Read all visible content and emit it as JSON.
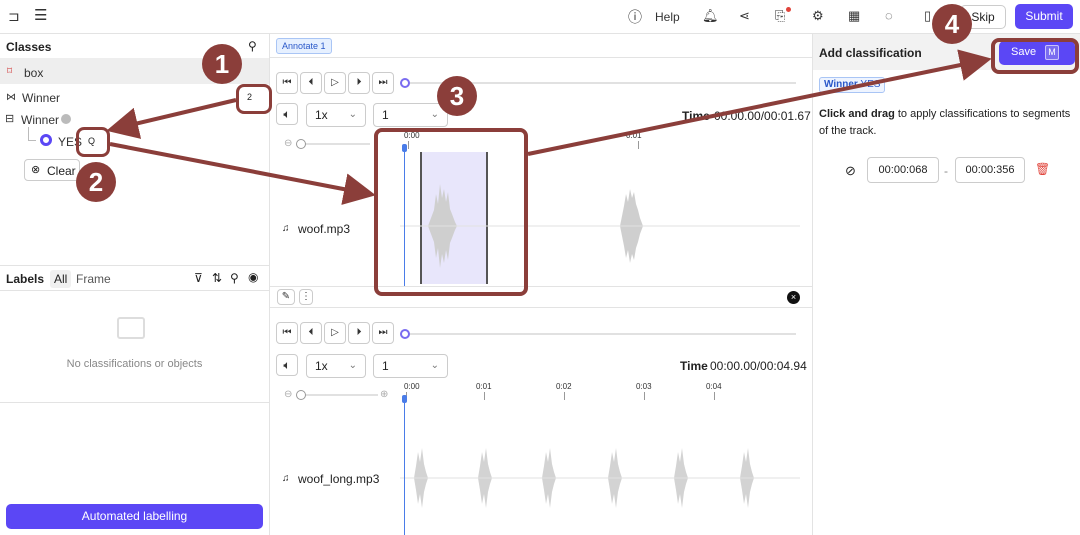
{
  "topbar": {
    "help_label": "Help",
    "skip_label": "Skip",
    "submit_label": "Submit"
  },
  "classes": {
    "title": "Classes",
    "items": [
      {
        "label": "box"
      },
      {
        "label": "Winner",
        "hotkey": "2"
      },
      {
        "label": "Winner",
        "option": "YES",
        "hotkey": "Q"
      }
    ],
    "clear_label": "Clear"
  },
  "labels": {
    "title": "Labels",
    "tab_all": "All",
    "tab_frame": "Frame",
    "empty_text": "No classifications or objects"
  },
  "auto_label": "Automated labelling",
  "annotate_tab": "Annotate 1",
  "players": [
    {
      "speed": "1x",
      "step": "1",
      "time_label": "Time",
      "time_value": "00:00.00/00:01.67",
      "file": "woof.mp3",
      "ticks": [
        "0:00",
        "0:01"
      ]
    },
    {
      "speed": "1x",
      "step": "1",
      "time_label": "Time",
      "time_value": "00:00.00/00:04.94",
      "file": "woof_long.mp3",
      "ticks": [
        "0:00",
        "0:01",
        "0:02",
        "0:03",
        "0:04"
      ]
    }
  ],
  "right": {
    "title": "Add classification",
    "save_label": "Save",
    "save_hotkey": "M",
    "tag_winner": "Winner",
    "tag_yes": "YES",
    "instr_bold": "Click and drag",
    "instr_rest": "to apply classifications to segments of the track.",
    "start_time": "00:00:068",
    "sep": "-",
    "end_time": "00:00:356"
  },
  "callouts": [
    "1",
    "2",
    "3",
    "4"
  ],
  "colors": {
    "accent": "#5b47f5",
    "callout": "#8b3e3a",
    "cursor": "#4a7ce8"
  }
}
